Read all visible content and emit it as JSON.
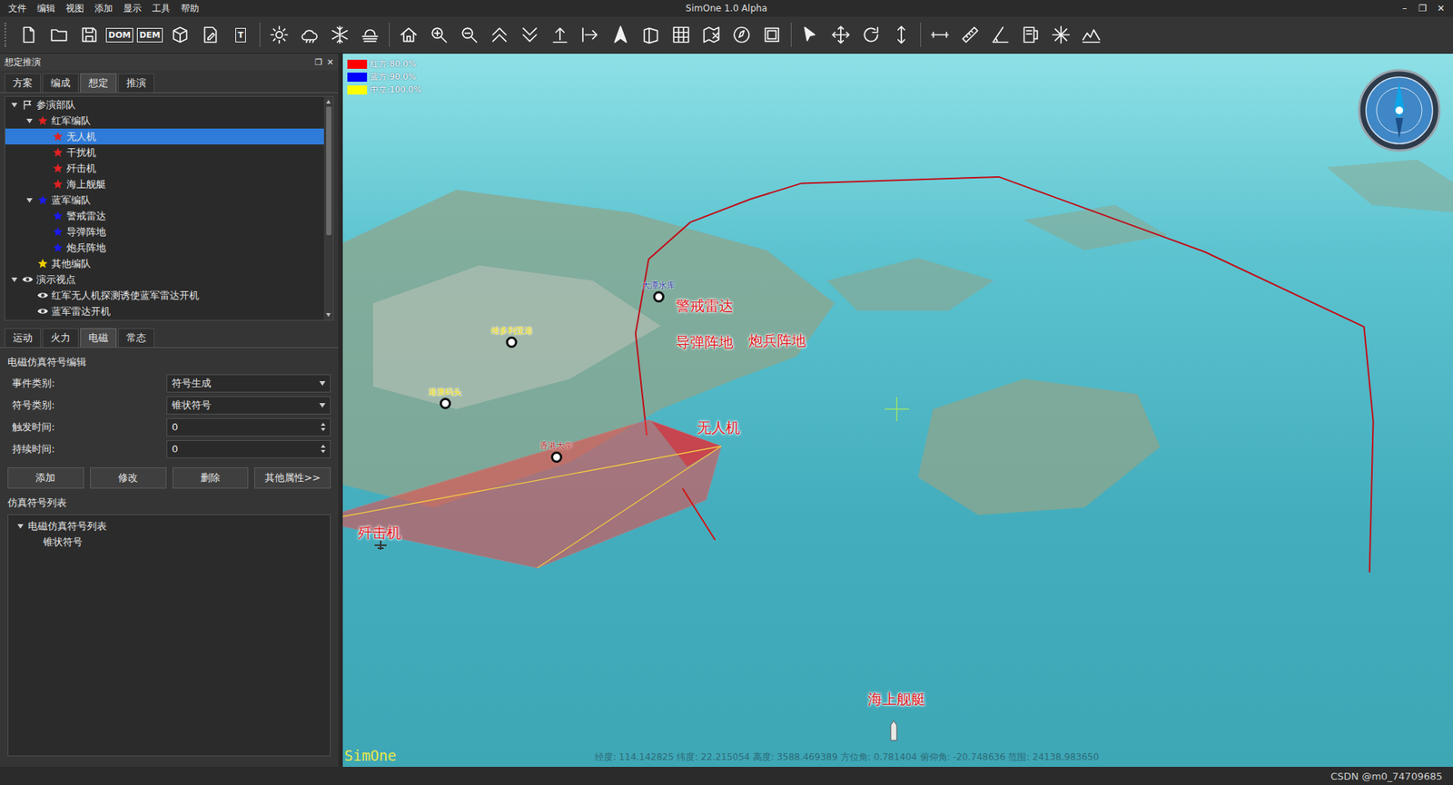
{
  "window": {
    "title": "SimOne 1.0 Alpha",
    "controls": [
      "–",
      "❐",
      "✕"
    ]
  },
  "menu": [
    "文件",
    "编辑",
    "视图",
    "添加",
    "显示",
    "工具",
    "帮助"
  ],
  "toolbar": {
    "text_buttons": [
      "DOM",
      "DEM",
      "T"
    ]
  },
  "panel": {
    "title": "想定推演",
    "controls": [
      "❐",
      "✕"
    ],
    "tabs": [
      {
        "label": "方案",
        "selected": false
      },
      {
        "label": "编成",
        "selected": false
      },
      {
        "label": "想定",
        "selected": true
      },
      {
        "label": "推演",
        "selected": false
      }
    ],
    "tree": [
      {
        "label": "参演部队",
        "depth": 0,
        "kind": "flag",
        "expanded": true,
        "leaf": false,
        "selected": false
      },
      {
        "label": "红军编队",
        "depth": 1,
        "kind": "star",
        "color": "#e02222",
        "expanded": true,
        "leaf": false,
        "selected": false
      },
      {
        "label": "无人机",
        "depth": 2,
        "kind": "star",
        "color": "#e02222",
        "expanded": false,
        "leaf": true,
        "selected": true
      },
      {
        "label": "干扰机",
        "depth": 2,
        "kind": "star",
        "color": "#e02222",
        "expanded": false,
        "leaf": true,
        "selected": false
      },
      {
        "label": "歼击机",
        "depth": 2,
        "kind": "star",
        "color": "#e02222",
        "expanded": false,
        "leaf": true,
        "selected": false
      },
      {
        "label": "海上舰艇",
        "depth": 2,
        "kind": "star",
        "color": "#e02222",
        "expanded": false,
        "leaf": true,
        "selected": false
      },
      {
        "label": "蓝军编队",
        "depth": 1,
        "kind": "star",
        "color": "#1a1aee",
        "expanded": true,
        "leaf": false,
        "selected": false
      },
      {
        "label": "警戒雷达",
        "depth": 2,
        "kind": "star",
        "color": "#1a1aee",
        "expanded": false,
        "leaf": true,
        "selected": false
      },
      {
        "label": "导弹阵地",
        "depth": 2,
        "kind": "star",
        "color": "#1a1aee",
        "expanded": false,
        "leaf": true,
        "selected": false
      },
      {
        "label": "炮兵阵地",
        "depth": 2,
        "kind": "star",
        "color": "#1a1aee",
        "expanded": false,
        "leaf": true,
        "selected": false
      },
      {
        "label": "其他编队",
        "depth": 1,
        "kind": "star",
        "color": "#f0d000",
        "expanded": false,
        "leaf": true,
        "selected": false
      },
      {
        "label": "演示视点",
        "depth": 0,
        "kind": "eye",
        "expanded": true,
        "leaf": false,
        "selected": false
      },
      {
        "label": "红军无人机探测诱使蓝军雷达开机",
        "depth": 1,
        "kind": "eye",
        "expanded": false,
        "leaf": true,
        "selected": false
      },
      {
        "label": "蓝军雷达开机",
        "depth": 1,
        "kind": "eye",
        "expanded": false,
        "leaf": true,
        "selected": false
      }
    ]
  },
  "editor": {
    "tabs": [
      {
        "label": "运动",
        "selected": false
      },
      {
        "label": "火力",
        "selected": false
      },
      {
        "label": "电磁",
        "selected": true
      },
      {
        "label": "常态",
        "selected": false
      }
    ],
    "section_title": "电磁仿真符号编辑",
    "fields": [
      {
        "label": "事件类别:",
        "value": "符号生成",
        "kind": "dropdown"
      },
      {
        "label": "符号类别:",
        "value": "锥状符号",
        "kind": "dropdown"
      },
      {
        "label": "触发时间:",
        "value": "0",
        "kind": "spinner"
      },
      {
        "label": "持续时间:",
        "value": "0",
        "kind": "spinner"
      }
    ],
    "buttons": [
      "添加",
      "修改",
      "删除",
      "其他属性>>"
    ],
    "list_title": "仿真符号列表",
    "list": [
      {
        "label": "电磁仿真符号列表",
        "depth": 0,
        "expanded": true,
        "leaf": false
      },
      {
        "label": "锥状符号",
        "depth": 1,
        "expanded": false,
        "leaf": true
      }
    ]
  },
  "map": {
    "legend": [
      {
        "label": "红方:80.0%",
        "color": "#ff0000"
      },
      {
        "label": "蓝方:90.0%",
        "color": "#0000ff"
      },
      {
        "label": "中立:100.0%",
        "color": "#ffff00"
      }
    ],
    "units": [
      {
        "label": "警戒雷达"
      },
      {
        "label": "导弹阵地"
      },
      {
        "label": "炮兵阵地"
      },
      {
        "label": "无人机"
      },
      {
        "label": "歼击机"
      },
      {
        "label": "海上舰艇"
      }
    ],
    "places": [
      {
        "label": "大潭水库",
        "color": "#1c2fa0"
      },
      {
        "label": "维多利亚港",
        "color": "#e8d800"
      },
      {
        "label": "港澳码头",
        "color": "#e8d800"
      },
      {
        "label": "香港大学",
        "color": "#b01818"
      }
    ],
    "status": "经度: 114.142825  纬度: 22.215054  高度: 3588.469389  方位角: 0.781404  俯仰角: -20.748636  范围: 24138.983650",
    "watermark": "SimOne"
  },
  "status_bar": {
    "text": "CSDN @m0_74709685"
  }
}
